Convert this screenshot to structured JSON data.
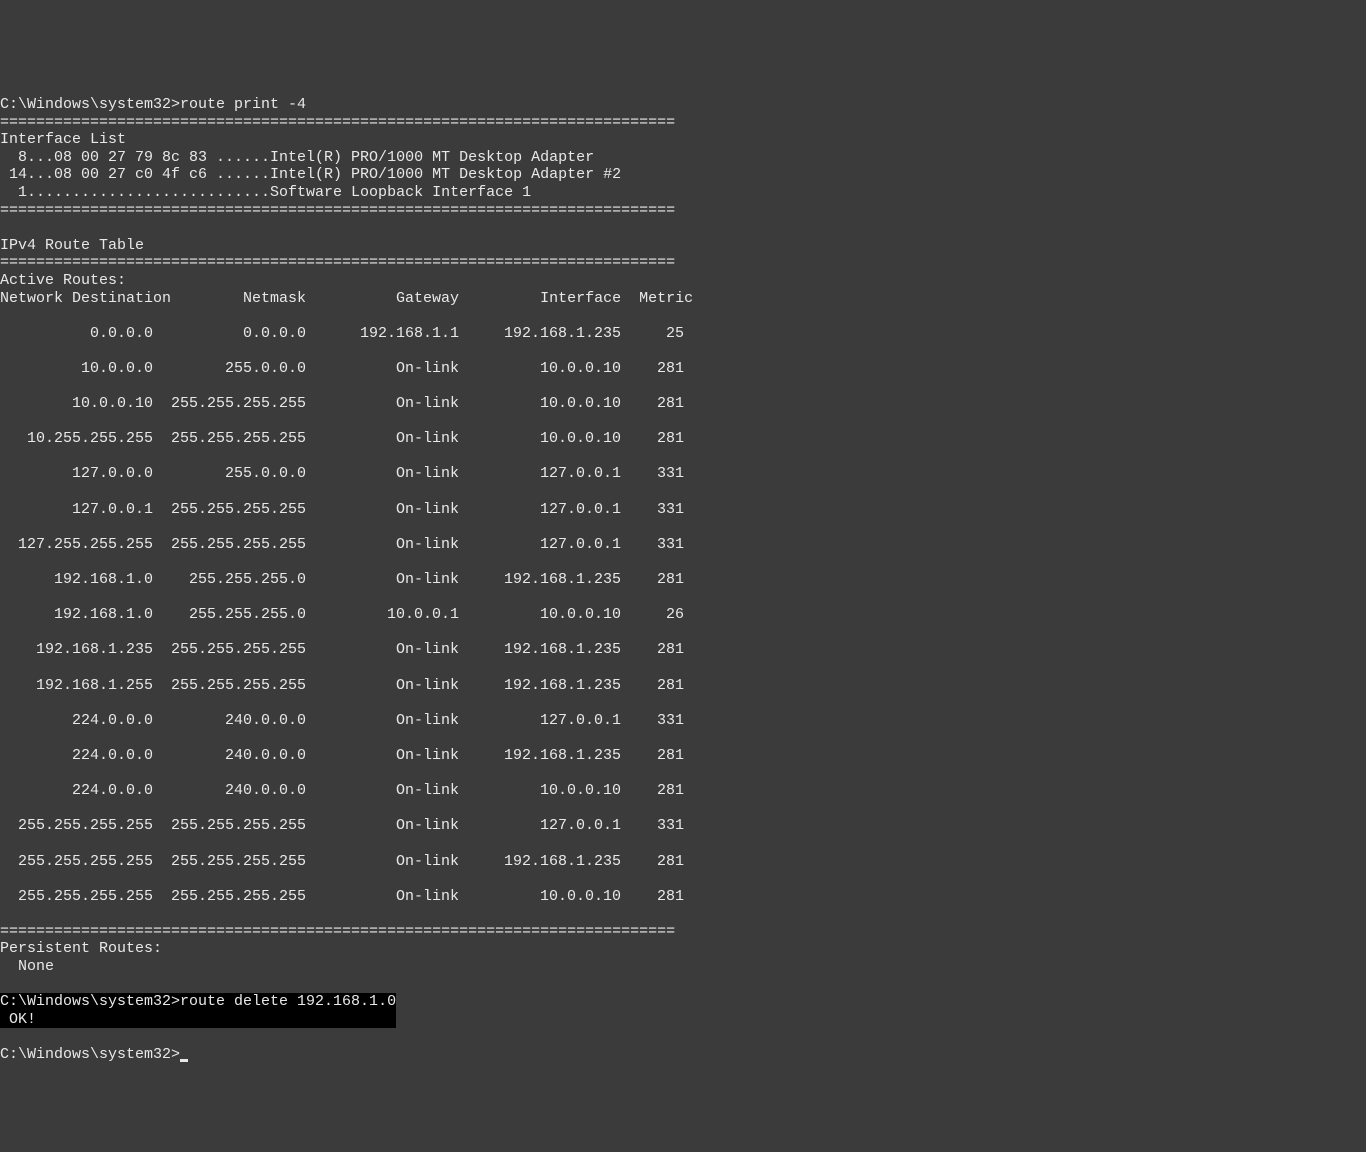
{
  "prompt1": "C:\\Windows\\system32>",
  "cmd1": "route print -4",
  "divider": "===========================================================================",
  "interface_list_header": "Interface List",
  "interfaces": [
    "  8...08 00 27 79 8c 83 ......Intel(R) PRO/1000 MT Desktop Adapter",
    " 14...08 00 27 c0 4f c6 ......Intel(R) PRO/1000 MT Desktop Adapter #2",
    "  1...........................Software Loopback Interface 1"
  ],
  "blank": "",
  "route_table_header": "IPv4 Route Table",
  "active_routes_header": "Active Routes:",
  "columns": {
    "dest": "Network Destination",
    "mask": "Netmask",
    "gw": "Gateway",
    "if": "Interface",
    "met": "Metric"
  },
  "routes": [
    {
      "dest": "0.0.0.0",
      "mask": "0.0.0.0",
      "gw": "192.168.1.1",
      "if": "192.168.1.235",
      "met": "25"
    },
    {
      "dest": "10.0.0.0",
      "mask": "255.0.0.0",
      "gw": "On-link",
      "if": "10.0.0.10",
      "met": "281"
    },
    {
      "dest": "10.0.0.10",
      "mask": "255.255.255.255",
      "gw": "On-link",
      "if": "10.0.0.10",
      "met": "281"
    },
    {
      "dest": "10.255.255.255",
      "mask": "255.255.255.255",
      "gw": "On-link",
      "if": "10.0.0.10",
      "met": "281"
    },
    {
      "dest": "127.0.0.0",
      "mask": "255.0.0.0",
      "gw": "On-link",
      "if": "127.0.0.1",
      "met": "331"
    },
    {
      "dest": "127.0.0.1",
      "mask": "255.255.255.255",
      "gw": "On-link",
      "if": "127.0.0.1",
      "met": "331"
    },
    {
      "dest": "127.255.255.255",
      "mask": "255.255.255.255",
      "gw": "On-link",
      "if": "127.0.0.1",
      "met": "331"
    },
    {
      "dest": "192.168.1.0",
      "mask": "255.255.255.0",
      "gw": "On-link",
      "if": "192.168.1.235",
      "met": "281"
    },
    {
      "dest": "192.168.1.0",
      "mask": "255.255.255.0",
      "gw": "10.0.0.1",
      "if": "10.0.0.10",
      "met": "26"
    },
    {
      "dest": "192.168.1.235",
      "mask": "255.255.255.255",
      "gw": "On-link",
      "if": "192.168.1.235",
      "met": "281"
    },
    {
      "dest": "192.168.1.255",
      "mask": "255.255.255.255",
      "gw": "On-link",
      "if": "192.168.1.235",
      "met": "281"
    },
    {
      "dest": "224.0.0.0",
      "mask": "240.0.0.0",
      "gw": "On-link",
      "if": "127.0.0.1",
      "met": "331"
    },
    {
      "dest": "224.0.0.0",
      "mask": "240.0.0.0",
      "gw": "On-link",
      "if": "192.168.1.235",
      "met": "281"
    },
    {
      "dest": "224.0.0.0",
      "mask": "240.0.0.0",
      "gw": "On-link",
      "if": "10.0.0.10",
      "met": "281"
    },
    {
      "dest": "255.255.255.255",
      "mask": "255.255.255.255",
      "gw": "On-link",
      "if": "127.0.0.1",
      "met": "331"
    },
    {
      "dest": "255.255.255.255",
      "mask": "255.255.255.255",
      "gw": "On-link",
      "if": "192.168.1.235",
      "met": "281"
    },
    {
      "dest": "255.255.255.255",
      "mask": "255.255.255.255",
      "gw": "On-link",
      "if": "10.0.0.10",
      "met": "281"
    }
  ],
  "persistent_header": "Persistent Routes:",
  "persistent_none": "  None",
  "prompt2": "C:\\Windows\\system32>",
  "cmd2": "route delete 192.168.1.0",
  "cmd2_result": " OK!",
  "prompt3": "C:\\Windows\\system32>"
}
